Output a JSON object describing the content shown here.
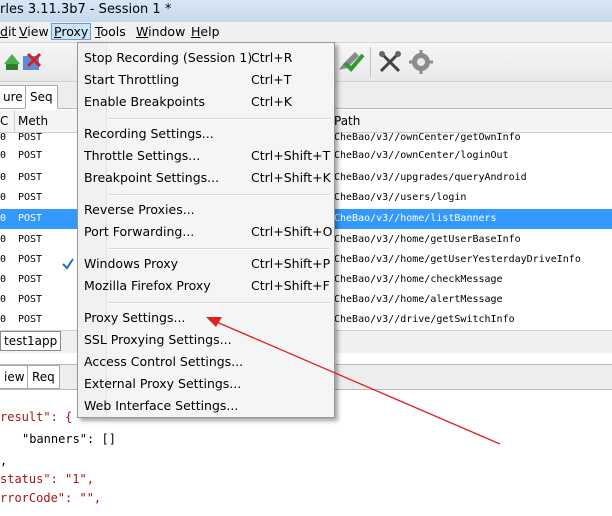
{
  "window": {
    "title": "rles 3.11.3b7 - Session 1 *"
  },
  "menubar": {
    "items": [
      {
        "label": "dit",
        "underline": "d"
      },
      {
        "label": "View",
        "underline": "V"
      },
      {
        "label": "Proxy",
        "underline": "P"
      },
      {
        "label": "Tools",
        "underline": "T"
      },
      {
        "label": "Window",
        "underline": "W"
      },
      {
        "label": "Help",
        "underline": "H"
      }
    ]
  },
  "toolbar": {
    "icons": [
      "record-icon",
      "clear-icon",
      "pencil-icon",
      "validate-check-icon",
      "tools-icon",
      "settings-gear-icon"
    ]
  },
  "tabs": {
    "structure": "ure",
    "sequence": "Seq"
  },
  "table": {
    "headers": {
      "code": "C",
      "method": "Meth",
      "path": "Path"
    },
    "rows": [
      {
        "code": "0",
        "method": "POST",
        "path": "CheBao/v3//ownCenter/getOwnInfo",
        "selected": false
      },
      {
        "code": "0",
        "method": "POST",
        "path": "CheBao/v3//ownCenter/loginOut",
        "selected": false
      },
      {
        "code": "0",
        "method": "POST",
        "path": "CheBao/v3//upgrades/queryAndroid",
        "selected": false
      },
      {
        "code": "0",
        "method": "POST",
        "path": "CheBao/v3//users/login",
        "selected": false
      },
      {
        "code": "0",
        "method": "POST",
        "path": "CheBao/v3//home/listBanners",
        "selected": true
      },
      {
        "code": "0",
        "method": "POST",
        "path": "CheBao/v3//home/getUserBaseInfo",
        "selected": false
      },
      {
        "code": "0",
        "method": "POST",
        "path": "CheBao/v3//home/getUserYesterdayDriveInfo",
        "selected": false
      },
      {
        "code": "0",
        "method": "POST",
        "path": "CheBao/v3//home/checkMessage",
        "selected": false
      },
      {
        "code": "0",
        "method": "POST",
        "path": "CheBao/v3//home/alertMessage",
        "selected": false
      },
      {
        "code": "0",
        "method": "POST",
        "path": "CheBao/v3//drive/getSwitchInfo",
        "selected": false
      }
    ]
  },
  "filter": {
    "value": "test1app"
  },
  "lower_tabs": {
    "overview": "iew",
    "request": "Req"
  },
  "json_lines": [
    "result\": {",
    "\"banners\": []",
    ",",
    "status\": \"1\",",
    "rrorCode\": \"\","
  ],
  "proxy_menu": {
    "sections": [
      [
        {
          "label": "Stop Recording (Session 1)",
          "shortcut": "Ctrl+R",
          "checked": false
        },
        {
          "label": "Start Throttling",
          "shortcut": "Ctrl+T",
          "checked": false
        },
        {
          "label": "Enable Breakpoints",
          "shortcut": "Ctrl+K",
          "checked": false
        }
      ],
      [
        {
          "label": "Recording Settings...",
          "shortcut": "",
          "checked": false
        },
        {
          "label": "Throttle Settings...",
          "shortcut": "Ctrl+Shift+T",
          "checked": false
        },
        {
          "label": "Breakpoint Settings...",
          "shortcut": "Ctrl+Shift+K",
          "checked": false
        }
      ],
      [
        {
          "label": "Reverse Proxies...",
          "shortcut": "",
          "checked": false
        },
        {
          "label": "Port Forwarding...",
          "shortcut": "Ctrl+Shift+O",
          "checked": false
        }
      ],
      [
        {
          "label": "Windows Proxy",
          "shortcut": "Ctrl+Shift+P",
          "checked": true
        },
        {
          "label": "Mozilla Firefox Proxy",
          "shortcut": "Ctrl+Shift+F",
          "checked": false
        }
      ],
      [
        {
          "label": "Proxy Settings...",
          "shortcut": "",
          "checked": false
        },
        {
          "label": "SSL Proxying Settings...",
          "shortcut": "",
          "checked": false
        },
        {
          "label": "Access Control Settings...",
          "shortcut": "",
          "checked": false
        },
        {
          "label": "External Proxy Settings...",
          "shortcut": "",
          "checked": false
        },
        {
          "label": "Web Interface Settings...",
          "shortcut": "",
          "checked": false
        }
      ]
    ]
  },
  "annotation": {
    "arrow_color": "#e02020"
  },
  "colors": {
    "selection": "#3399ff",
    "menu_open": "#cde3f7",
    "checkmark": "#1d6fce"
  }
}
